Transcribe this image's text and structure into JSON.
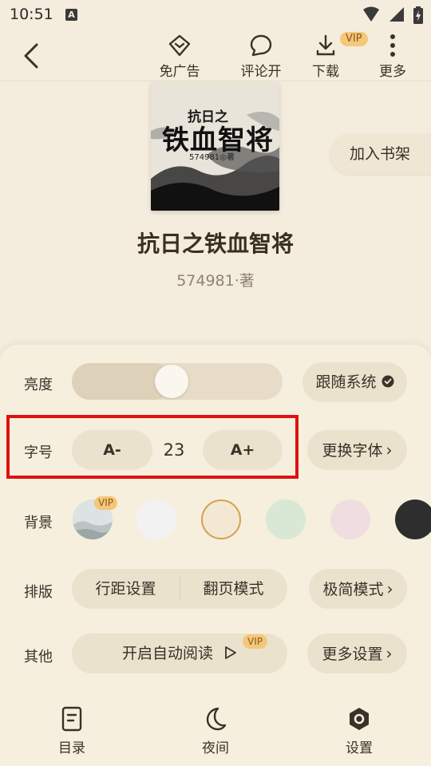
{
  "status_bar": {
    "time": "10:51",
    "notification_letter": "A"
  },
  "top_bar": {
    "back_icon": "chevron-left-icon",
    "actions": [
      {
        "label": "免广告",
        "icon": "ad-free-icon"
      },
      {
        "label": "评论开",
        "icon": "comment-icon"
      },
      {
        "label": "下载",
        "icon": "download-icon",
        "badge": "VIP"
      },
      {
        "label": "更多",
        "icon": "more-vertical-icon"
      }
    ]
  },
  "book": {
    "cover_title_top": "抗日之",
    "cover_title_main": "铁血智将",
    "cover_author": "574981◎著",
    "title": "抗日之铁血智将",
    "author": "574981·著",
    "add_to_shelf": "加入书架"
  },
  "settings": {
    "brightness": {
      "label": "亮度",
      "level": 0.47,
      "follow_system": "跟随系统"
    },
    "font_size": {
      "label": "字号",
      "decrease": "A-",
      "value": "23",
      "increase": "A+",
      "change_font": "更换字体"
    },
    "background": {
      "label": "背景",
      "vip_badge": "VIP",
      "swatches": [
        {
          "name": "ink-landscape",
          "color": "#dce3e2",
          "vip": true
        },
        {
          "name": "white",
          "color": "#f2f2f2"
        },
        {
          "name": "cream",
          "color": "#f2e8d3",
          "selected": true
        },
        {
          "name": "green",
          "color": "#d8e8d4"
        },
        {
          "name": "pink",
          "color": "#f0dde0"
        },
        {
          "name": "dark",
          "color": "#2e2e2e"
        }
      ]
    },
    "layout": {
      "label": "排版",
      "line_spacing": "行距设置",
      "page_mode": "翻页模式",
      "minimal_mode": "极简模式"
    },
    "other": {
      "label": "其他",
      "auto_read": "开启自动阅读",
      "vip_badge": "VIP",
      "more_settings": "更多设置"
    }
  },
  "bottom_nav": [
    {
      "label": "目录",
      "icon": "catalog-icon"
    },
    {
      "label": "夜间",
      "icon": "moon-icon"
    },
    {
      "label": "设置",
      "icon": "settings-icon"
    }
  ],
  "colors": {
    "accent_red": "#e01010",
    "vip_gold": "#f5c77a",
    "panel_bg": "#f6efde",
    "text_dark": "#3a3128"
  }
}
